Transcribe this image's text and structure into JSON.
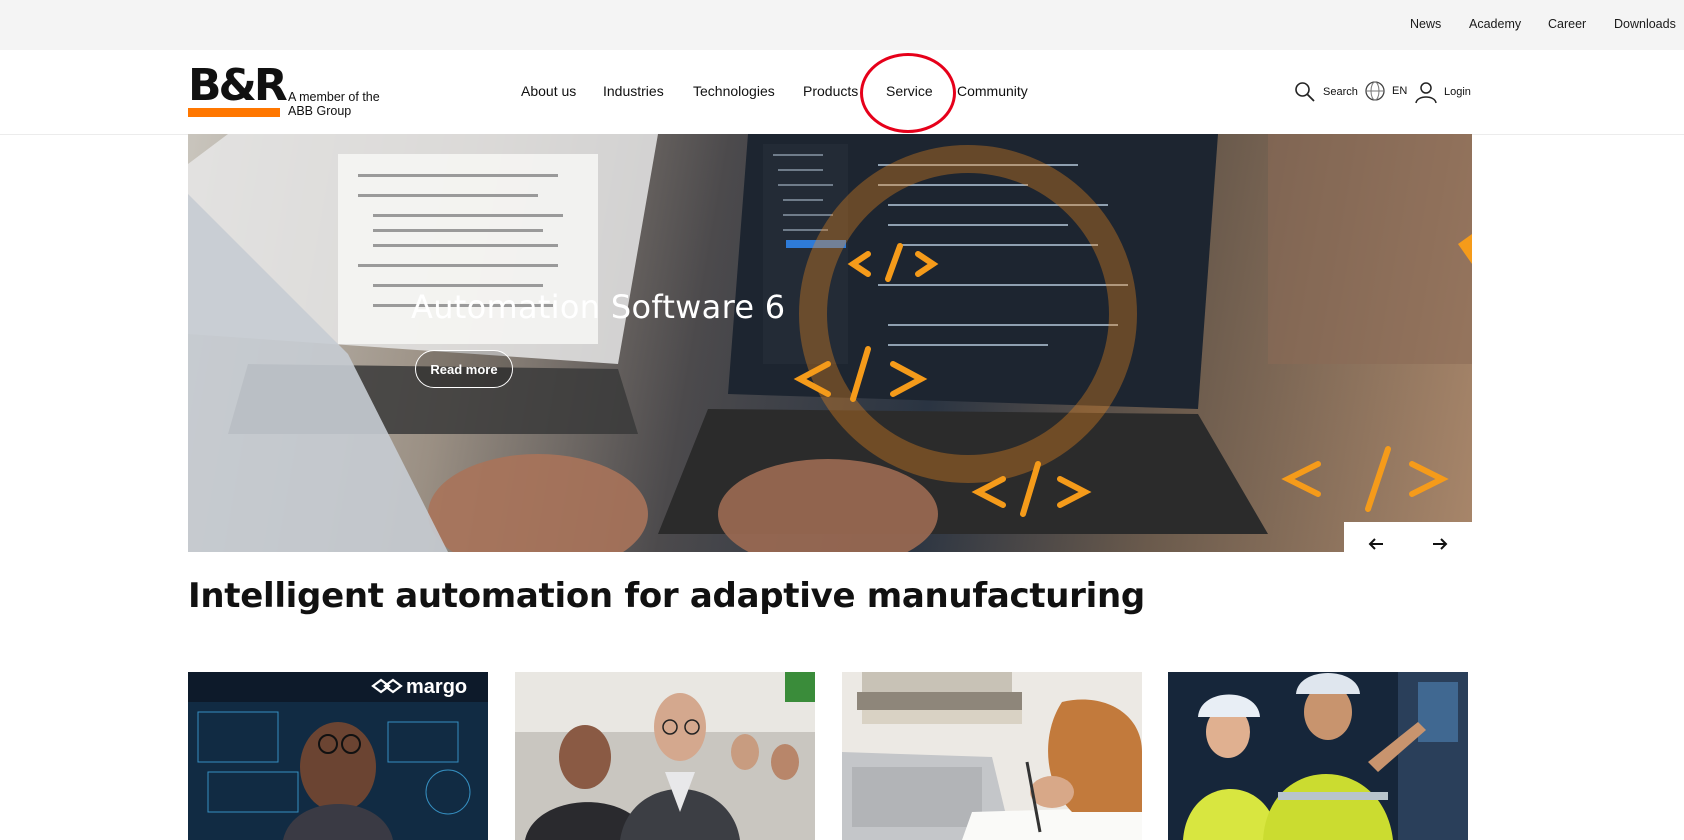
{
  "topbar": {
    "links": [
      "News",
      "Academy",
      "Career",
      "Downloads"
    ]
  },
  "logo": {
    "mark": "B&R",
    "tagline": "A member of the ABB Group"
  },
  "nav": {
    "items": [
      "About us",
      "Industries",
      "Technologies",
      "Products",
      "Service",
      "Community"
    ]
  },
  "utility": {
    "search": "Search",
    "language": "EN",
    "login": "Login"
  },
  "hero": {
    "title": "Automation Software 6",
    "cta": "Read more",
    "prev_icon": "arrow-left-icon",
    "next_icon": "arrow-right-icon"
  },
  "headline": "Intelligent automation for adaptive manufacturing",
  "cards": [
    {
      "badge": "margo",
      "image": "woman-with-holographic-display"
    },
    {
      "image": "trade-fair-conversation"
    },
    {
      "image": "writing-notes-laptop"
    },
    {
      "image": "engineers-in-hardhats"
    }
  ],
  "colors": {
    "brand_orange": "#ff7700",
    "annotation_red": "#e6001a",
    "topbar_bg": "#f4f4f4"
  }
}
